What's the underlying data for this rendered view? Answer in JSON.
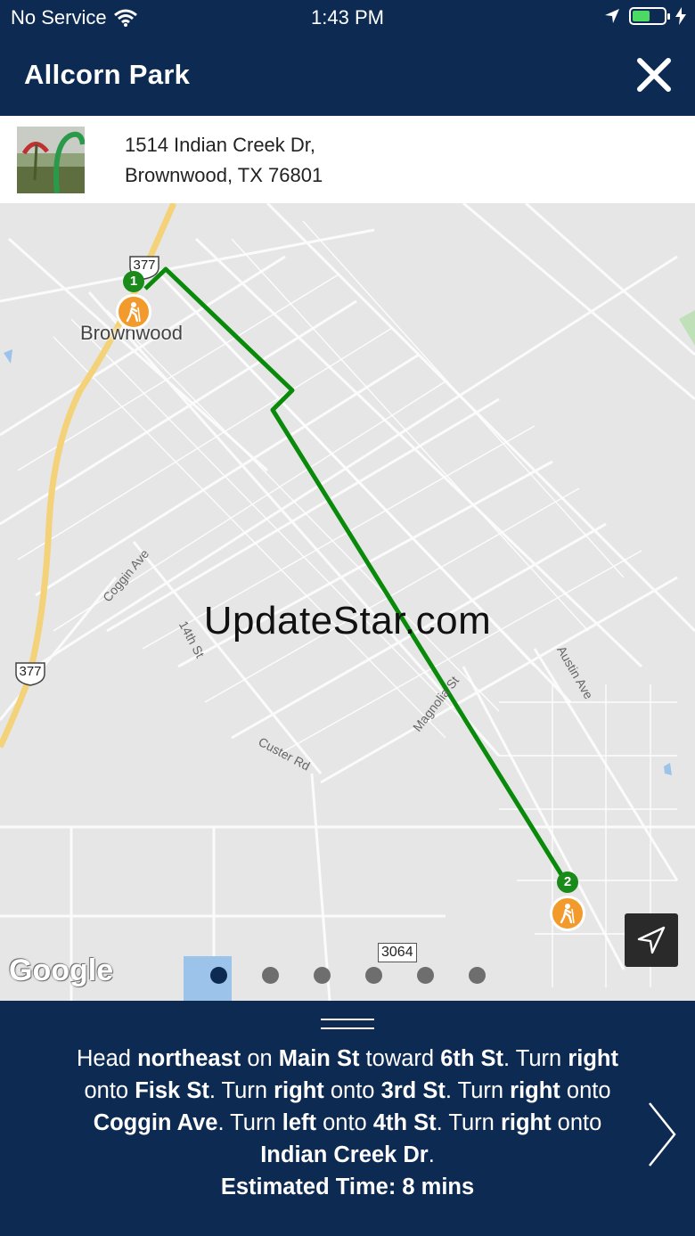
{
  "status_bar": {
    "carrier": "No Service",
    "time": "1:43 PM",
    "battery_level": 0.55,
    "icons": [
      "wifi-icon",
      "location-arrow-icon",
      "battery-icon",
      "charging-bolt-icon"
    ]
  },
  "header": {
    "title": "Allcorn Park",
    "close_icon": "close-icon"
  },
  "location": {
    "address_line1": "1514 Indian Creek Dr,",
    "address_line2": "Brownwood, TX 76801"
  },
  "map": {
    "watermark": "UpdateStar.com",
    "city_label": "Brownwood",
    "route_color": "#0a8a0a",
    "start_marker": "1",
    "end_marker": "2",
    "highway_shield_top": "377",
    "highway_shield_left": "377",
    "route_shield": "3064",
    "streets": {
      "coggin": "Coggin Ave",
      "fourteenth": "14th St",
      "custer": "Custer Rd",
      "magnolia": "Magnolia St",
      "austin": "Austin Ave"
    },
    "provider_logo": "Google",
    "locate_icon": "navigation-arrow-icon"
  },
  "pager": {
    "count": 6,
    "active_index": 0
  },
  "directions": {
    "segments": [
      {
        "text": "Head ",
        "bold": false
      },
      {
        "text": "northeast",
        "bold": true
      },
      {
        "text": " on ",
        "bold": false
      },
      {
        "text": "Main St",
        "bold": true
      },
      {
        "text": " toward ",
        "bold": false
      },
      {
        "text": "6th St",
        "bold": true
      },
      {
        "text": ". Turn ",
        "bold": false
      },
      {
        "text": "right",
        "bold": true
      },
      {
        "text": " onto ",
        "bold": false
      },
      {
        "text": "Fisk St",
        "bold": true
      },
      {
        "text": ". Turn ",
        "bold": false
      },
      {
        "text": "right",
        "bold": true
      },
      {
        "text": " onto ",
        "bold": false
      },
      {
        "text": "3rd St",
        "bold": true
      },
      {
        "text": ". Turn ",
        "bold": false
      },
      {
        "text": "right",
        "bold": true
      },
      {
        "text": " onto ",
        "bold": false
      },
      {
        "text": "Coggin Ave",
        "bold": true
      },
      {
        "text": ". Turn ",
        "bold": false
      },
      {
        "text": "left",
        "bold": true
      },
      {
        "text": " onto ",
        "bold": false
      },
      {
        "text": "4th St",
        "bold": true
      },
      {
        "text": ". Turn ",
        "bold": false
      },
      {
        "text": "right",
        "bold": true
      },
      {
        "text": " onto ",
        "bold": false
      },
      {
        "text": "Indian Creek Dr",
        "bold": true
      },
      {
        "text": ".",
        "bold": false
      }
    ],
    "estimated_time": "Estimated Time: 8 mins",
    "next_icon": "chevron-right-icon"
  }
}
